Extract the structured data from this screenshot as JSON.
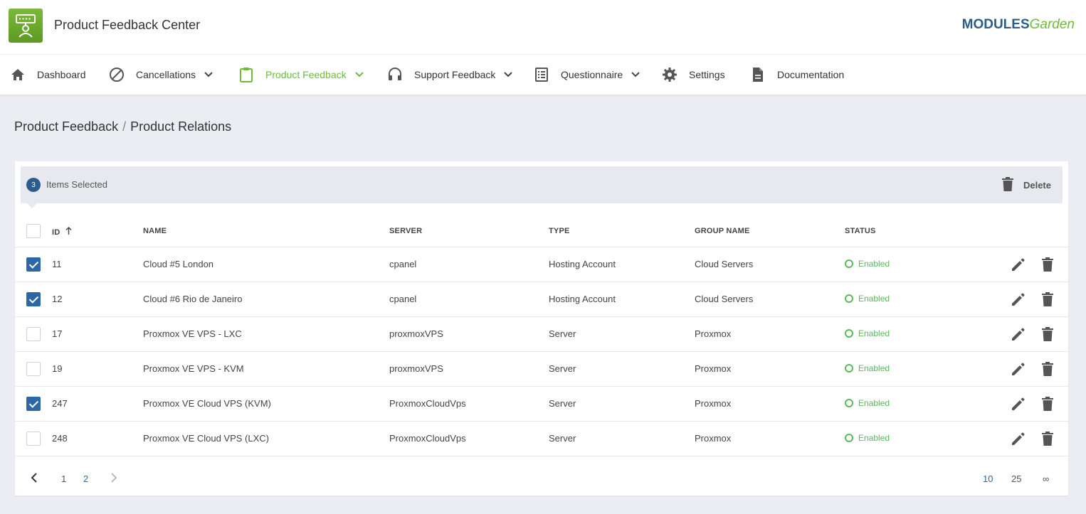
{
  "header": {
    "title": "Product Feedback Center",
    "brand_modules": "MODULES",
    "brand_garden": "Garden"
  },
  "nav": [
    {
      "label": "Dashboard",
      "icon": "home-icon",
      "dropdown": false,
      "active": false
    },
    {
      "label": "Cancellations",
      "icon": "block-icon",
      "dropdown": true,
      "active": false
    },
    {
      "label": "Product Feedback",
      "icon": "clipboard-icon",
      "dropdown": true,
      "active": true
    },
    {
      "label": "Support Feedback",
      "icon": "headset-icon",
      "dropdown": true,
      "active": false
    },
    {
      "label": "Questionnaire",
      "icon": "checklist-icon",
      "dropdown": true,
      "active": false
    },
    {
      "label": "Settings",
      "icon": "gear-icon",
      "dropdown": false,
      "active": false
    },
    {
      "label": "Documentation",
      "icon": "document-icon",
      "dropdown": false,
      "active": false
    }
  ],
  "breadcrumb": {
    "parent": "Product Feedback",
    "separator": "/",
    "current": "Product Relations"
  },
  "selection": {
    "count": "3",
    "label": "Items Selected",
    "delete_label": "Delete"
  },
  "table": {
    "columns": {
      "id": "ID",
      "name": "NAME",
      "server": "SERVER",
      "type": "TYPE",
      "group": "GROUP NAME",
      "status": "STATUS"
    },
    "rows": [
      {
        "checked": true,
        "id": "11",
        "name": "Cloud #5 London",
        "server": "cpanel",
        "type": "Hosting Account",
        "group": "Cloud Servers",
        "status": "Enabled"
      },
      {
        "checked": true,
        "id": "12",
        "name": "Cloud #6 Rio de Janeiro",
        "server": "cpanel",
        "type": "Hosting Account",
        "group": "Cloud Servers",
        "status": "Enabled"
      },
      {
        "checked": false,
        "id": "17",
        "name": "Proxmox VE VPS - LXC",
        "server": "proxmoxVPS",
        "type": "Server",
        "group": "Proxmox",
        "status": "Enabled"
      },
      {
        "checked": false,
        "id": "19",
        "name": "Proxmox VE VPS - KVM",
        "server": "proxmoxVPS",
        "type": "Server",
        "group": "Proxmox",
        "status": "Enabled"
      },
      {
        "checked": true,
        "id": "247",
        "name": "Proxmox VE Cloud VPS (KVM)",
        "server": "ProxmoxCloudVps",
        "type": "Server",
        "group": "Proxmox",
        "status": "Enabled"
      },
      {
        "checked": false,
        "id": "248",
        "name": "Proxmox VE Cloud VPS (LXC)",
        "server": "ProxmoxCloudVps",
        "type": "Server",
        "group": "Proxmox",
        "status": "Enabled"
      }
    ]
  },
  "pagination": {
    "pages": [
      "1",
      "2"
    ],
    "current_page": "2",
    "per_page_options": [
      "10",
      "25",
      "∞"
    ],
    "current_per_page": "10"
  },
  "colors": {
    "accent_green": "#6cbc3a",
    "primary_blue": "#2c67a6",
    "status_enabled": "#5cb85c"
  }
}
